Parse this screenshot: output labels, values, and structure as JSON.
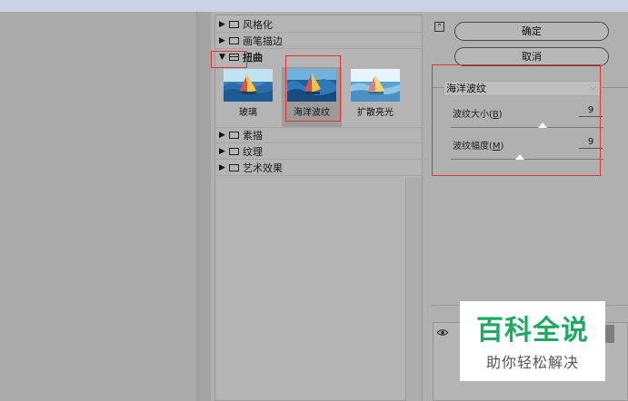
{
  "filter_gallery": {
    "categories": [
      {
        "label": "风格化",
        "expanded": false
      },
      {
        "label": "画笔描边",
        "expanded": false
      },
      {
        "label": "扭曲",
        "expanded": true
      },
      {
        "label": "素描",
        "expanded": false
      },
      {
        "label": "纹理",
        "expanded": false
      },
      {
        "label": "艺术效果",
        "expanded": false
      }
    ],
    "distort_filters": [
      {
        "label": "玻璃"
      },
      {
        "label": "海洋波纹",
        "selected": true
      },
      {
        "label": "扩散亮光"
      }
    ]
  },
  "buttons": {
    "ok_label": "确定",
    "cancel_label": "取消"
  },
  "settings": {
    "selected_filter": "海洋波纹",
    "params": [
      {
        "label": "波纹大小(",
        "key": "B",
        "value": "9",
        "level": 0.6
      },
      {
        "label": "波纹幅度(",
        "key": "M",
        "value": "9",
        "level": 0.45
      }
    ]
  },
  "watermark": {
    "title": "百科全说",
    "subtitle": "助你轻松解决"
  },
  "colors": {
    "highlight": "#e0342e",
    "watermark_green": "#1faa63"
  }
}
